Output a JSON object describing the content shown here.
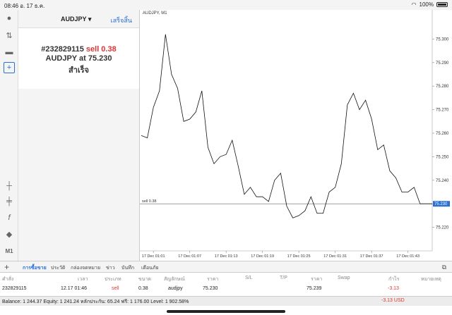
{
  "statusbar": {
    "time": "08:46",
    "date": "อ. 17 ธ.ค.",
    "battery": "100%"
  },
  "order": {
    "symbol": "AUDJPY",
    "done_label": "เสร็จสิ้น",
    "ticket": "#232829115",
    "action": "sell 0.38",
    "line2": "AUDJPY at 75.230",
    "line3": "สำเร็จ"
  },
  "left_tools": [
    "user-icon",
    "arrows-icon",
    "chat-icon",
    "new-order-icon",
    "crosshair-icon",
    "candles-icon",
    "function-icon",
    "objects-icon",
    "timeframe"
  ],
  "timeframe": "M1",
  "chart": {
    "title": "AUDJPY, M1",
    "order_line_label": "sell 0.38",
    "price_tag": "75.230"
  },
  "chart_data": {
    "type": "line",
    "title": "AUDJPY, M1",
    "ylim": [
      75.21,
      75.31
    ],
    "y_ticks": [
      "75.300",
      "75.290",
      "75.280",
      "75.270",
      "75.260",
      "75.250",
      "75.240",
      "75.230",
      "75.220"
    ],
    "x_ticks": [
      "17 Dec 01:01",
      "17 Dec 01:07",
      "17 Dec 01:13",
      "17 Dec 01:19",
      "17 Dec 01:25",
      "17 Dec 01:31",
      "17 Dec 01:37",
      "17 Dec 01:43"
    ],
    "order_level": 75.23,
    "values": [
      75.259,
      75.258,
      75.271,
      75.278,
      75.302,
      75.285,
      75.279,
      75.265,
      75.266,
      75.269,
      75.278,
      75.254,
      75.247,
      75.25,
      75.251,
      75.257,
      75.246,
      75.234,
      75.237,
      75.233,
      75.233,
      75.231,
      75.24,
      75.243,
      75.229,
      75.224,
      75.225,
      75.227,
      75.233,
      75.226,
      75.226,
      75.235,
      75.237,
      75.247,
      75.272,
      75.277,
      75.27,
      75.274,
      75.266,
      75.253,
      75.255,
      75.244,
      75.241,
      75.235,
      75.235,
      75.237,
      75.23,
      75.23,
      75.23
    ]
  },
  "tabs": [
    "การซื้อขาย",
    "ประวัติ",
    "กล่องจดหมาย",
    "ข่าว",
    "บันทึก",
    "เตือนภัย"
  ],
  "table": {
    "headers": [
      "คำสั่ง",
      "เวลา",
      "ประเภท",
      "ขนาด",
      "สัญลักษณ์",
      "ราคา",
      "S/L",
      "T/P",
      "ราคา",
      "Swap",
      "กำไร",
      "หมายเหตุ"
    ],
    "row": [
      "232829115",
      "12.17 01:46",
      "sell",
      "0.38",
      "audjpy",
      "75.230",
      "",
      "",
      "75.239",
      "",
      "-3.13",
      ""
    ]
  },
  "balance": {
    "text": "Balance: 1 244.37 Equity: 1 241.24 หลักประกัน: 65.24 ฟรี: 1 176.00 Level: 1 902.58%",
    "value": "-3.13  USD"
  }
}
